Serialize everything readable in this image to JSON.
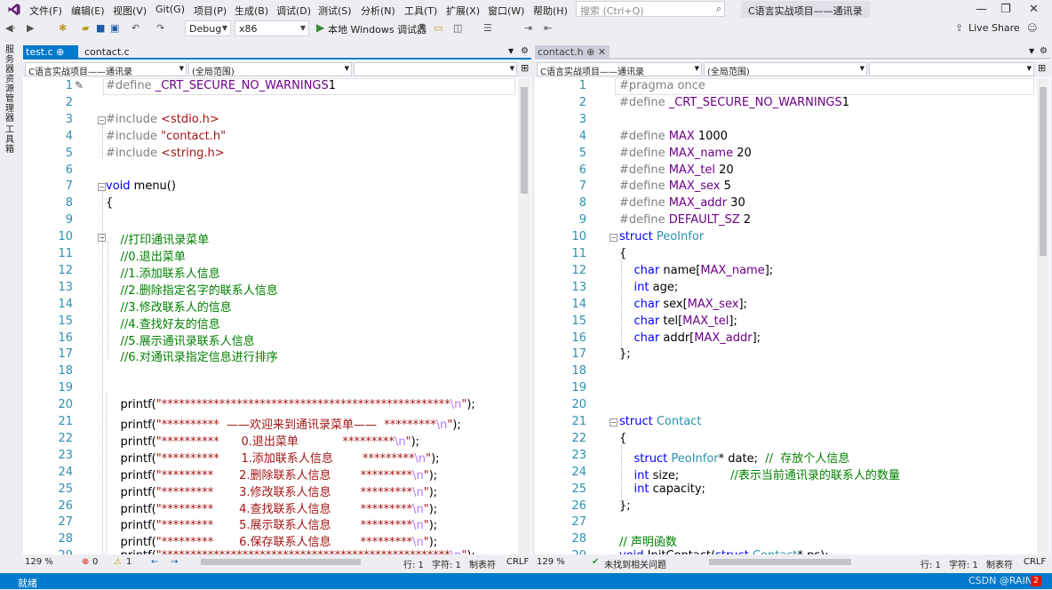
{
  "menu": {
    "items": [
      "文件(F)",
      "编辑(E)",
      "视图(V)",
      "Git(G)",
      "项目(P)",
      "生成(B)",
      "调试(D)",
      "测试(S)",
      "分析(N)",
      "工具(T)",
      "扩展(X)",
      "窗口(W)",
      "帮助(H)"
    ],
    "search_placeholder": "搜索 (Ctrl+Q)",
    "project_title": "C语言实战项目——通讯录",
    "live_share": "Live Share"
  },
  "toolbar": {
    "config": "Debug",
    "platform": "x86",
    "run": "本地 Windows 调试器"
  },
  "side": {
    "server_explorer": "服务器资源管理器",
    "toolbox": "工具箱"
  },
  "left": {
    "tab_active": "test.c",
    "tab_other": "contact.c",
    "nav_project": "C语言实战项目——通讯录",
    "nav_scope": "(全局范围)",
    "zoom": "129 %",
    "errors": "0",
    "warnings": "1",
    "line": "行: 1",
    "col": "字符: 1",
    "tabs_mode": "制表符",
    "eol": "CRLF"
  },
  "right": {
    "tab_active": "contact.h",
    "nav_project": "C语言实战项目——通讯录",
    "nav_scope": "(全局范围)",
    "zoom": "129 %",
    "issues": "未找到相关问题",
    "line": "行: 1",
    "col": "字符: 1",
    "tabs_mode": "制表符",
    "eol": "CRLF"
  },
  "left_code": [
    {
      "n": "1",
      "t": [
        [
          "pp",
          "#define "
        ],
        [
          "mac",
          "_CRT_SECURE_NO_WARNINGS"
        ],
        [
          "",
          "1"
        ]
      ]
    },
    {
      "n": "2",
      "t": []
    },
    {
      "n": "3",
      "t": [
        [
          "pp",
          "#include "
        ],
        [
          "str",
          "<stdio.h>"
        ]
      ]
    },
    {
      "n": "4",
      "t": [
        [
          "pp",
          "#include "
        ],
        [
          "str",
          "\"contact.h\""
        ]
      ]
    },
    {
      "n": "5",
      "t": [
        [
          "pp",
          "#include "
        ],
        [
          "str",
          "<string.h>"
        ]
      ]
    },
    {
      "n": "6",
      "t": []
    },
    {
      "n": "7",
      "t": [
        [
          "kw",
          "void "
        ],
        [
          "",
          "menu()"
        ]
      ]
    },
    {
      "n": "8",
      "t": [
        [
          "",
          "{"
        ]
      ]
    },
    {
      "n": "9",
      "t": []
    },
    {
      "n": "10",
      "t": [
        [
          "cm",
          "    //打印通讯录菜单"
        ]
      ]
    },
    {
      "n": "11",
      "t": [
        [
          "cm",
          "    //0.退出菜单"
        ]
      ]
    },
    {
      "n": "12",
      "t": [
        [
          "cm",
          "    //1.添加联系人信息"
        ]
      ]
    },
    {
      "n": "13",
      "t": [
        [
          "cm",
          "    //2.删除指定名字的联系人信息"
        ]
      ]
    },
    {
      "n": "14",
      "t": [
        [
          "cm",
          "    //3.修改联系人的信息"
        ]
      ]
    },
    {
      "n": "15",
      "t": [
        [
          "cm",
          "    //4.查找好友的信息"
        ]
      ]
    },
    {
      "n": "16",
      "t": [
        [
          "cm",
          "    //5.展示通讯录联系人信息"
        ]
      ]
    },
    {
      "n": "17",
      "t": [
        [
          "cm",
          "    //6.对通讯录指定信息进行排序"
        ]
      ]
    },
    {
      "n": "18",
      "t": []
    },
    {
      "n": "19",
      "t": []
    },
    {
      "n": "20",
      "t": [
        [
          "",
          "    printf("
        ],
        [
          "str",
          "\"**************************************************"
        ],
        [
          "esc",
          "\\n"
        ],
        [
          "str",
          "\""
        ],
        [
          "",
          ");"
        ]
      ]
    },
    {
      "n": "21",
      "t": [
        [
          "",
          "    printf("
        ],
        [
          "str",
          "\"**********  ——欢迎来到通讯录菜单——  *********"
        ],
        [
          "esc",
          "\\n"
        ],
        [
          "str",
          "\""
        ],
        [
          "",
          ");"
        ]
      ]
    },
    {
      "n": "22",
      "t": [
        [
          "",
          "    printf("
        ],
        [
          "str",
          "\"**********      0.退出菜单            *********"
        ],
        [
          "esc",
          "\\n"
        ],
        [
          "str",
          "\""
        ],
        [
          "",
          ");"
        ]
      ]
    },
    {
      "n": "23",
      "t": [
        [
          "",
          "    printf("
        ],
        [
          "str",
          "\"**********      1.添加联系人信息        *********"
        ],
        [
          "esc",
          "\\n"
        ],
        [
          "str",
          "\""
        ],
        [
          "",
          ");"
        ]
      ]
    },
    {
      "n": "24",
      "t": [
        [
          "",
          "    printf("
        ],
        [
          "str",
          "\"*********       2.删除联系人信息        *********"
        ],
        [
          "esc",
          "\\n"
        ],
        [
          "str",
          "\""
        ],
        [
          "",
          ");"
        ]
      ]
    },
    {
      "n": "25",
      "t": [
        [
          "",
          "    printf("
        ],
        [
          "str",
          "\"*********       3.修改联系人信息        *********"
        ],
        [
          "esc",
          "\\n"
        ],
        [
          "str",
          "\""
        ],
        [
          "",
          ");"
        ]
      ]
    },
    {
      "n": "26",
      "t": [
        [
          "",
          "    printf("
        ],
        [
          "str",
          "\"*********       4.查找联系人信息        *********"
        ],
        [
          "esc",
          "\\n"
        ],
        [
          "str",
          "\""
        ],
        [
          "",
          ");"
        ]
      ]
    },
    {
      "n": "27",
      "t": [
        [
          "",
          "    printf("
        ],
        [
          "str",
          "\"*********       5.展示联系人信息        *********"
        ],
        [
          "esc",
          "\\n"
        ],
        [
          "str",
          "\""
        ],
        [
          "",
          ");"
        ]
      ]
    },
    {
      "n": "28",
      "t": [
        [
          "",
          "    printf("
        ],
        [
          "str",
          "\"*********       6.保存联系人信息        *********"
        ],
        [
          "esc",
          "\\n"
        ],
        [
          "str",
          "\""
        ],
        [
          "",
          ");"
        ]
      ]
    },
    {
      "n": "29",
      "t": [
        [
          "",
          "    printf("
        ],
        [
          "str",
          "\"**************************************************"
        ],
        [
          "esc",
          "\\n"
        ],
        [
          "str",
          "\""
        ],
        [
          "",
          ");"
        ]
      ]
    }
  ],
  "right_code": [
    {
      "n": "1",
      "t": [
        [
          "pp",
          "#pragma once"
        ]
      ]
    },
    {
      "n": "2",
      "t": [
        [
          "pp",
          "#define "
        ],
        [
          "mac",
          "_CRT_SECURE_NO_WARNINGS"
        ],
        [
          "",
          "1"
        ]
      ]
    },
    {
      "n": "3",
      "t": []
    },
    {
      "n": "4",
      "t": [
        [
          "pp",
          "#define "
        ],
        [
          "mac",
          "MAX"
        ],
        [
          "",
          " 1000"
        ]
      ]
    },
    {
      "n": "5",
      "t": [
        [
          "pp",
          "#define "
        ],
        [
          "mac",
          "MAX_name"
        ],
        [
          "",
          " 20"
        ]
      ]
    },
    {
      "n": "6",
      "t": [
        [
          "pp",
          "#define "
        ],
        [
          "mac",
          "MAX_tel"
        ],
        [
          "",
          " 20"
        ]
      ]
    },
    {
      "n": "7",
      "t": [
        [
          "pp",
          "#define "
        ],
        [
          "mac",
          "MAX_sex"
        ],
        [
          "",
          " 5"
        ]
      ]
    },
    {
      "n": "8",
      "t": [
        [
          "pp",
          "#define "
        ],
        [
          "mac",
          "MAX_addr"
        ],
        [
          "",
          " 30"
        ]
      ]
    },
    {
      "n": "9",
      "t": [
        [
          "pp",
          "#define "
        ],
        [
          "mac",
          "DEFAULT_SZ"
        ],
        [
          "",
          " 2"
        ]
      ]
    },
    {
      "n": "10",
      "t": [
        [
          "kw",
          "struct "
        ],
        [
          "ty",
          "PeoInfor"
        ]
      ]
    },
    {
      "n": "11",
      "t": [
        [
          "",
          "{"
        ]
      ]
    },
    {
      "n": "12",
      "t": [
        [
          "kw",
          "    char "
        ],
        [
          "",
          "name["
        ],
        [
          "mac",
          "MAX_name"
        ],
        [
          "",
          "];"
        ]
      ]
    },
    {
      "n": "13",
      "t": [
        [
          "kw",
          "    int "
        ],
        [
          "",
          "age;"
        ]
      ]
    },
    {
      "n": "14",
      "t": [
        [
          "kw",
          "    char "
        ],
        [
          "",
          "sex["
        ],
        [
          "mac",
          "MAX_sex"
        ],
        [
          "",
          "];"
        ]
      ]
    },
    {
      "n": "15",
      "t": [
        [
          "kw",
          "    char "
        ],
        [
          "",
          "tel["
        ],
        [
          "mac",
          "MAX_tel"
        ],
        [
          "",
          "];"
        ]
      ]
    },
    {
      "n": "16",
      "t": [
        [
          "kw",
          "    char "
        ],
        [
          "",
          "addr["
        ],
        [
          "mac",
          "MAX_addr"
        ],
        [
          "",
          "];"
        ]
      ]
    },
    {
      "n": "17",
      "t": [
        [
          "",
          "};"
        ]
      ]
    },
    {
      "n": "18",
      "t": []
    },
    {
      "n": "19",
      "t": []
    },
    {
      "n": "20",
      "t": []
    },
    {
      "n": "21",
      "t": [
        [
          "kw",
          "struct "
        ],
        [
          "ty",
          "Contact"
        ]
      ]
    },
    {
      "n": "22",
      "t": [
        [
          "",
          "{"
        ]
      ]
    },
    {
      "n": "23",
      "t": [
        [
          "kw",
          "    struct "
        ],
        [
          "ty",
          "PeoInfor"
        ],
        [
          "",
          "* date;  "
        ],
        [
          "cm",
          "//  存放个人信息"
        ]
      ]
    },
    {
      "n": "24",
      "t": [
        [
          "kw",
          "    int "
        ],
        [
          "",
          "size;              "
        ],
        [
          "cm",
          "//表示当前通讯录的联系人的数量"
        ]
      ]
    },
    {
      "n": "25",
      "t": [
        [
          "kw",
          "    int "
        ],
        [
          "",
          "capacity;"
        ]
      ]
    },
    {
      "n": "26",
      "t": [
        [
          "",
          "};"
        ]
      ]
    },
    {
      "n": "27",
      "t": []
    },
    {
      "n": "28",
      "t": [
        [
          "cm",
          "// 声明函数"
        ]
      ]
    },
    {
      "n": "29",
      "t": [
        [
          "kw",
          "void "
        ],
        [
          "",
          "InitContact("
        ],
        [
          "kw",
          "struct "
        ],
        [
          "ty",
          "Contact"
        ],
        [
          "",
          "* ps);"
        ]
      ]
    }
  ],
  "status": {
    "ready": "就绪",
    "watermark": "CSDN @RAIN 7"
  }
}
